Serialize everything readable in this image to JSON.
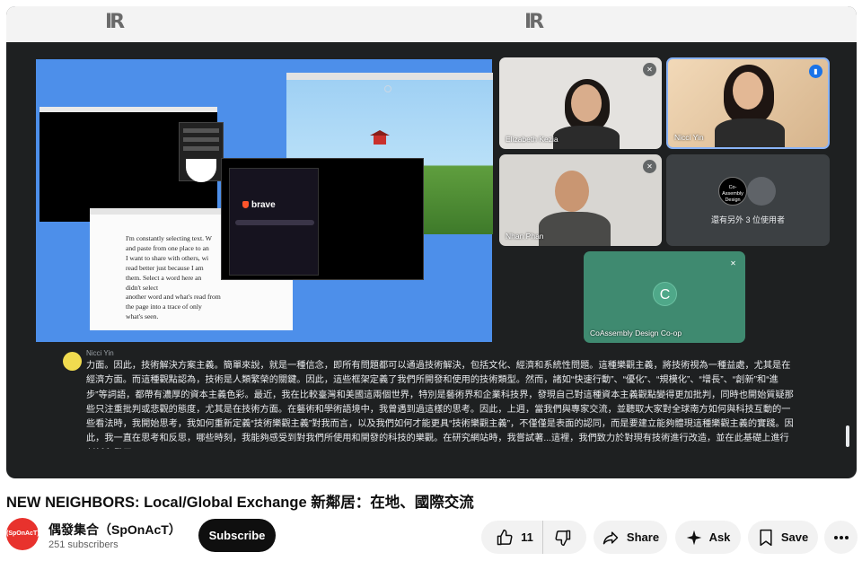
{
  "topbar": {
    "logo_left": "IR",
    "logo_right": "IR"
  },
  "shared_screen": {
    "doc_lines": [
      "I'm constantly selecting text. W",
      "and paste from one place to an",
      "I want to share with others, wi",
      "read better just because I am",
      "them. Select a word here an",
      "didn't    select",
      "another word and         what's read from",
      "                  the page into a trace of only",
      "what's seen."
    ],
    "brave_label": "brave"
  },
  "participants": {
    "elizabeth": {
      "name": "Elizabeth Kezia",
      "mic": "muted"
    },
    "nicci": {
      "name": "Nicci Yin",
      "mic": "speaking"
    },
    "nhan": {
      "name": "Nhan Phan",
      "mic": "muted"
    },
    "others": {
      "label": "還有另外 3 位使用者",
      "avatar_text": "Co-Assembly Design"
    },
    "coassembly": {
      "name": "CoAssembly Design Co-op",
      "initial": "C",
      "mic": "muted"
    }
  },
  "caption": {
    "speaker": "Nicci Yin",
    "text": "力面。因此，技術解決方案主義。簡單來說，就是一種信念，即所有問題都可以通過技術解決，包括文化、經濟和系統性問題。這種樂觀主義，將技術視為一種益處，尤其是在經濟方面。而這種觀點認為，技術是人類繁榮的關鍵。因此，這些框架定義了我們所開發和使用的技術類型。然而，諸如“快速行動”、“優化”、“規模化”、“增長”、“創新”和“進步”等詞語，都帶有濃厚的資本主義色彩。最近，我在比較臺灣和美國這兩個世界，特別是藝術界和企業科技界，發現自己對這種資本主義觀點變得更加批判，同時也開始質疑那些只注重批判或悲觀的態度，尤其是在技術方面。在藝術和學術語境中，我曾遇到過這樣的思考。因此，上週，當我們與專家交流，並聽取大家對全球南方如何與科技互動的一些看法時，我開始思考，我如何重新定義“技術樂觀主義”對我而言，以及我們如何才能更具“技術樂觀主義”，不僅僅是表面的認同，而是要建立能夠體現這種樂觀主義的實踐。因此，我一直在思考和反思，哪些時刻，我能夠感受到對我們所使用和開發的科技的樂觀。在研究網站時，我嘗試著...這裡，我們致力於對現有技術進行改造，並在此基礎上進行創新和發展。"
  },
  "video": {
    "title": "NEW NEIGHBORS: Local/Global Exchange 新鄰居：在地、國際交流"
  },
  "channel": {
    "avatar_text": "(SpOnAcT)",
    "name": "偶發集合（SpOnAcT）",
    "subscribers": "251 subscribers",
    "subscribe_label": "Subscribe"
  },
  "actions": {
    "like_count": "11",
    "share_label": "Share",
    "ask_label": "Ask",
    "save_label": "Save"
  },
  "icons": [
    "like-icon",
    "dislike-icon",
    "share-icon",
    "ask-icon",
    "save-icon",
    "more-icon",
    "mic-off-icon",
    "speaking-icon"
  ],
  "colors": {
    "player_bg": "#1e2021",
    "share_bg": "#4d8fea",
    "coassembly_bg": "#3f8a70",
    "subscribe_bg": "#0f0f0f",
    "channel_red": "#e8322d"
  }
}
